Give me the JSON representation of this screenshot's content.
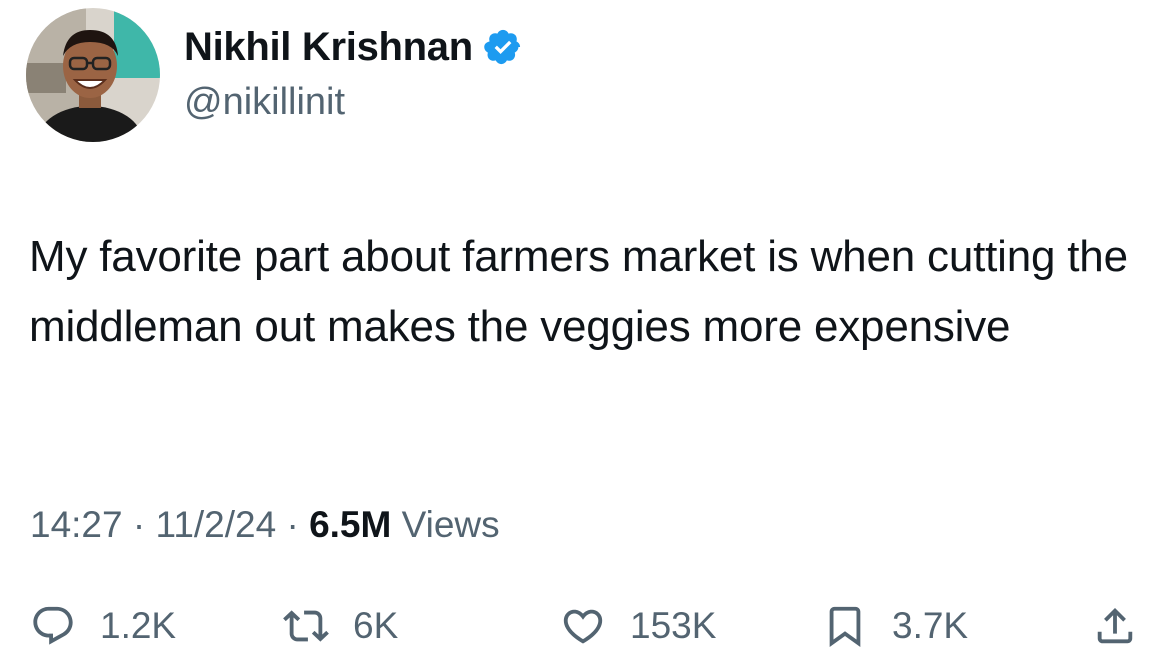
{
  "author": {
    "display_name": "Nikhil Krishnan",
    "handle": "@nikillinit",
    "verified": true,
    "verified_color": "#1d9bf0"
  },
  "tweet": {
    "text": "My favorite part about farmers market is when cutting the middleman out makes the veggies more expensive"
  },
  "meta": {
    "time": "14:27",
    "separator": "·",
    "date": "11/2/24",
    "views_count": "6.5M",
    "views_label": "Views"
  },
  "actions": {
    "replies": "1.2K",
    "reposts": "6K",
    "likes": "153K",
    "bookmarks": "3.7K"
  },
  "icons": [
    "reply-icon",
    "repost-icon",
    "like-icon",
    "bookmark-icon",
    "share-icon",
    "verified-badge-icon"
  ]
}
